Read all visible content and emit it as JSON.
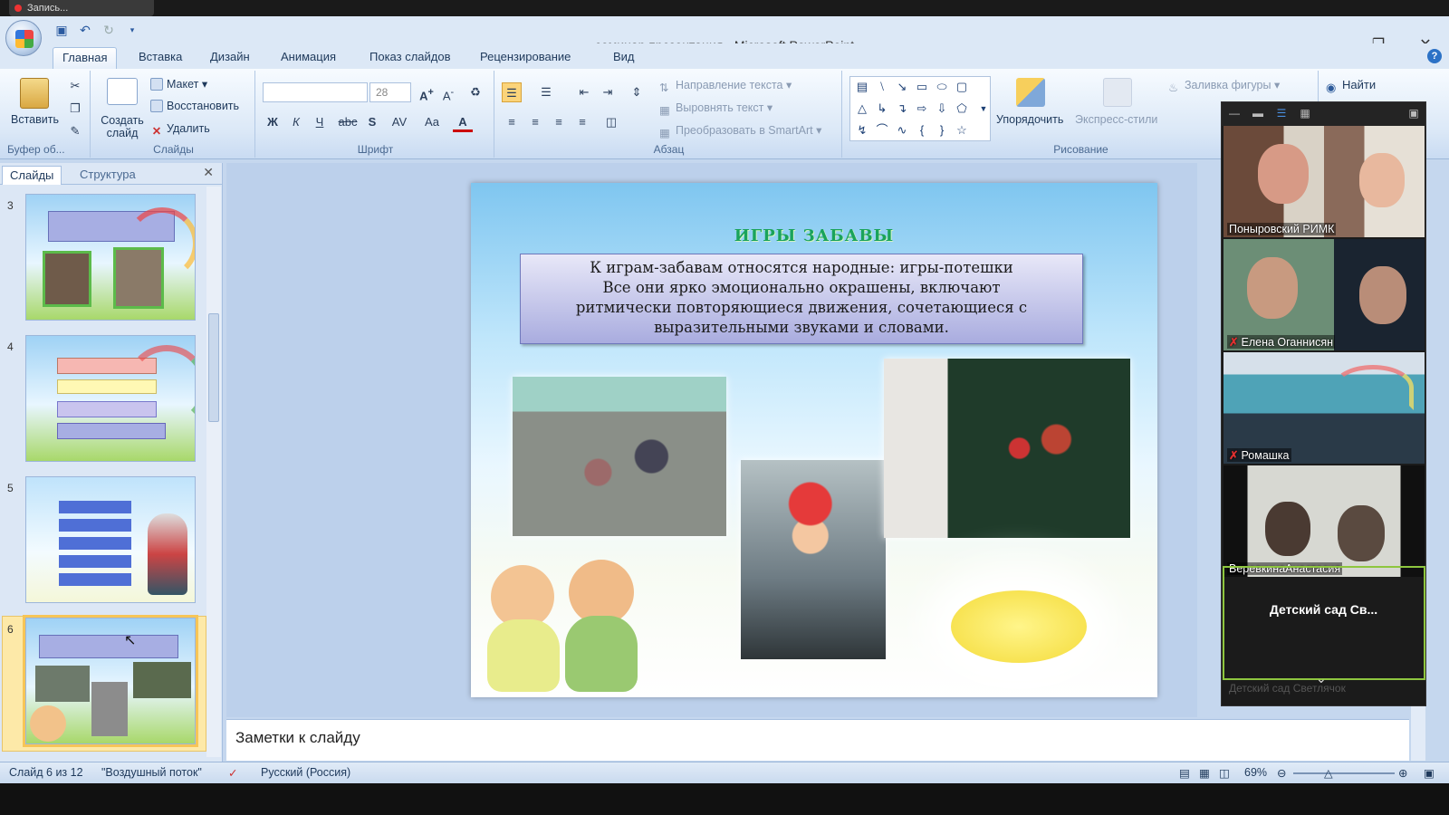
{
  "recording": {
    "label": "Запись..."
  },
  "window": {
    "title": "семинар презентация - Microsoft PowerPoint"
  },
  "tabs": [
    "Главная",
    "Вставка",
    "Дизайн",
    "Анимация",
    "Показ слайдов",
    "Рецензирование",
    "Вид"
  ],
  "ribbon": {
    "clipboard": {
      "paste": "Вставить",
      "label": "Буфер об..."
    },
    "slides": {
      "new_slide": "Создать слайд",
      "layout": "Макет",
      "reset": "Восстановить",
      "delete": "Удалить",
      "label": "Слайды"
    },
    "font": {
      "size": "28",
      "bold": "Ж",
      "italic": "К",
      "underline": "Ч",
      "strike": "abc",
      "shadow": "S",
      "spacing": "AV",
      "case": "Aa",
      "color": "A",
      "label": "Шрифт"
    },
    "paragraph": {
      "text_direction": "Направление текста",
      "align_text": "Выровнять текст",
      "smartart": "Преобразовать в SmartArt",
      "label": "Абзац"
    },
    "drawing": {
      "arrange": "Упорядочить",
      "quick_styles": "Экспресс-стили",
      "fill": "Заливка фигуры",
      "label": "Рисование"
    },
    "editing": {
      "find": "Найти"
    }
  },
  "panel": {
    "tab_slides": "Слайды",
    "tab_outline": "Структура",
    "thumbs": [
      "3",
      "4",
      "5",
      "6"
    ]
  },
  "slide": {
    "title": "ИГРЫ ЗАБАВЫ",
    "lines": [
      "К играм-забавам относятся народные: игры-потешки",
      "Все они ярко эмоционально окрашены, включают",
      "ритмически повторяющиеся движения, сочетающиеся с",
      "выразительными звуками и словами."
    ]
  },
  "notes": {
    "placeholder": "Заметки к слайду"
  },
  "status": {
    "slide_of": "Слайд 6 из 12",
    "theme": "\"Воздушный поток\"",
    "language": "Русский (Россия)",
    "zoom": "69%"
  },
  "video": {
    "participants": [
      {
        "name": "Поныровский РИМК",
        "muted": false
      },
      {
        "name": "Елена Оганнисян",
        "muted": true
      },
      {
        "name": "Ромашка",
        "muted": true
      },
      {
        "name": "ВеревкинаАнастасия",
        "muted": false
      }
    ],
    "more_label": "Детский  сад  Св...",
    "more_sub": "Детский сад Светлячок"
  }
}
